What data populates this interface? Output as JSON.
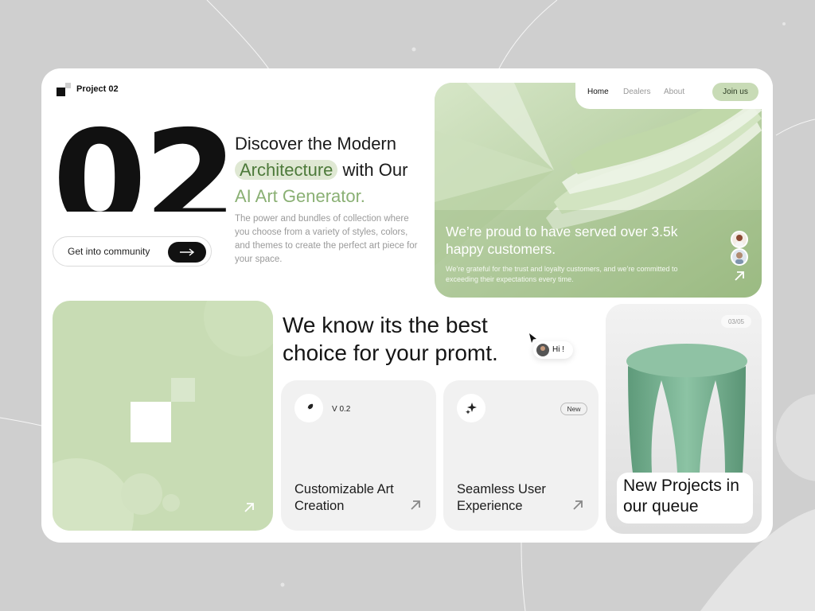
{
  "brand": {
    "name": "Project 02"
  },
  "hero": {
    "number": "02",
    "headline_part1": "Discover the ",
    "headline_modern": "Modern",
    "headline_highlight": "Architecture",
    "headline_part2": " with Our",
    "headline_green": "AI Art Generator.",
    "description": "The power and bundles of collection where you choose from a variety of styles, colors, and themes to create the perfect art piece for your space.",
    "cta_label": "Get into community"
  },
  "nav": {
    "items": [
      {
        "label": "Home"
      },
      {
        "label": "Dealers"
      },
      {
        "label": "About"
      }
    ],
    "join_label": "Join us"
  },
  "banner": {
    "title": "We’re proud to have served over 3.5k happy customers.",
    "subtitle": "We’re grateful for the trust and loyalty customers, and we’re committed to exceeding their expectations every time."
  },
  "section": {
    "heading": "We know its the best choice for your promt.",
    "chat_bubble": "Hi !"
  },
  "features": [
    {
      "version": "V 0.2",
      "title": "Customizable Art Creation"
    },
    {
      "badge": "New",
      "title": "Seamless User Experience"
    }
  ],
  "projects": {
    "counter": "03/05",
    "label": "New Projects in our queue"
  },
  "colors": {
    "accent_green": "#8ab074",
    "soft_green": "#c8dcb4",
    "highlight_bg": "#dfe8d3",
    "dark": "#111111",
    "stool_green": "#6fa88a"
  },
  "icons": [
    "arrow-right-icon",
    "arrow-up-right-icon",
    "feather-icon",
    "sparkle-icon",
    "cursor-icon"
  ]
}
